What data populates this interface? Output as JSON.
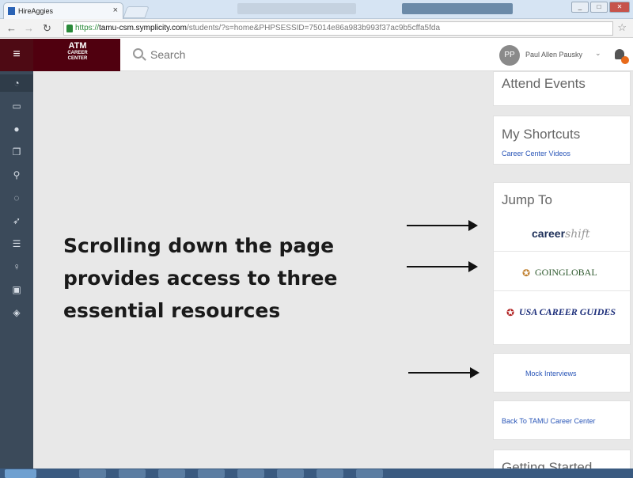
{
  "browser": {
    "tab_title": "HireAggies",
    "tab_close": "×",
    "url_scheme": "https://",
    "url_host": "tamu-csm.symplicity.com",
    "url_path": "/students/?s=home&PHPSESSID=75014e86a983b993f37ac9b5cffa5fda",
    "win_minimize": "_",
    "win_maximize": "□",
    "win_close": "✕"
  },
  "header": {
    "brand_mark": "ATM",
    "brand_line1": "CAREER",
    "brand_line2": "CENTER",
    "search_placeholder": "Search",
    "avatar_initials": "PP",
    "user_name": "Paul Allen Pausky",
    "user_chevron": "⌄"
  },
  "rail_icons": [
    "dashboard-icon",
    "briefcase-icon",
    "info-icon",
    "documents-icon",
    "signpost-icon",
    "chat-icon",
    "rocket-icon",
    "list-icon",
    "lightbulb-icon",
    "calendar-icon",
    "graduation-cap-icon"
  ],
  "overlay": {
    "line1": "Scrolling down the page",
    "line2": "provides access to three",
    "line3": "essential resources"
  },
  "cards": {
    "attend_events": "Attend Events",
    "my_shortcuts": "My Shortcuts",
    "career_center_videos": "Career Center Videos",
    "jump_to": "Jump To",
    "careershift_a": "career",
    "careershift_b": "shift",
    "goinglobal": "GOINGLOBAL",
    "usa_career_guides": "USA CAREER GUIDES",
    "mock_interviews": "Mock Interviews",
    "back_to_tamu": "Back To TAMU Career Center",
    "getting_started": "Getting Started"
  },
  "colors": {
    "brand_maroon": "#50000f",
    "rail_bg": "#3b4a5a",
    "link_blue": "#2a56b8",
    "notification_orange": "#e86a1a"
  }
}
